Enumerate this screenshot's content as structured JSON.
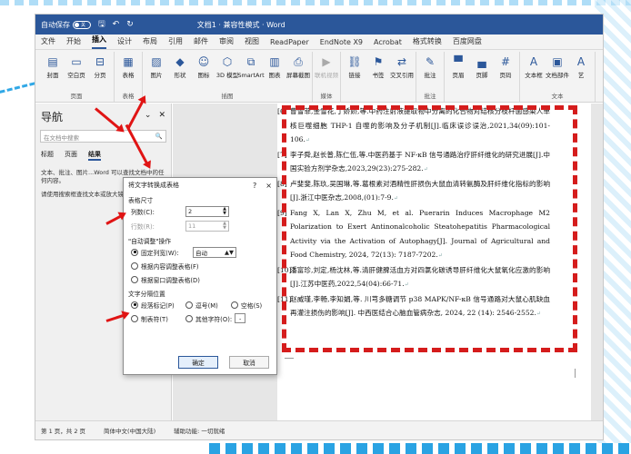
{
  "window": {
    "autosave_label": "自动保存",
    "autosave_state": "关",
    "title": "文档1 · 兼容性模式 · Word"
  },
  "tabs": [
    "文件",
    "开始",
    "插入",
    "设计",
    "布局",
    "引用",
    "邮件",
    "审阅",
    "视图",
    "ReadPaper",
    "EndNote X9",
    "Acrobat",
    "格式转换",
    "百度网盘"
  ],
  "ribbon": {
    "groups": [
      {
        "label": "页面",
        "buttons": [
          {
            "label": "封面",
            "icon": "cover-page-icon"
          },
          {
            "label": "空白页",
            "icon": "blank-page-icon"
          },
          {
            "label": "分页",
            "icon": "page-break-icon"
          }
        ]
      },
      {
        "label": "表格",
        "buttons": [
          {
            "label": "表格",
            "icon": "table-icon"
          }
        ]
      },
      {
        "label": "插图",
        "buttons": [
          {
            "label": "图片",
            "icon": "picture-icon"
          },
          {
            "label": "形状",
            "icon": "shapes-icon"
          },
          {
            "label": "图标",
            "icon": "icons-icon"
          },
          {
            "label": "3D 模型",
            "icon": "3d-model-icon"
          },
          {
            "label": "SmartArt",
            "icon": "smartart-icon"
          },
          {
            "label": "图表",
            "icon": "chart-icon"
          },
          {
            "label": "屏幕截图",
            "icon": "screenshot-icon"
          }
        ]
      },
      {
        "label": "媒体",
        "buttons": [
          {
            "label": "联机视频",
            "icon": "online-video-icon",
            "disabled": true
          }
        ]
      },
      {
        "label": "",
        "buttons": [
          {
            "label": "链接",
            "icon": "link-icon"
          },
          {
            "label": "书签",
            "icon": "bookmark-icon"
          },
          {
            "label": "交叉引用",
            "icon": "cross-reference-icon"
          }
        ]
      },
      {
        "label": "批注",
        "buttons": [
          {
            "label": "批注",
            "icon": "comment-icon"
          }
        ]
      },
      {
        "label": "",
        "buttons": [
          {
            "label": "页眉",
            "icon": "header-icon"
          },
          {
            "label": "页脚",
            "icon": "footer-icon"
          },
          {
            "label": "页码",
            "icon": "page-number-icon"
          }
        ]
      },
      {
        "label": "文本",
        "buttons": [
          {
            "label": "文本框",
            "icon": "text-box-icon"
          },
          {
            "label": "文档部件",
            "icon": "quick-parts-icon"
          },
          {
            "label": "艺",
            "icon": "wordart-icon"
          }
        ]
      }
    ]
  },
  "nav": {
    "title": "导航",
    "search_placeholder": "在文档中搜索",
    "tabs": [
      "标题",
      "页面",
      "结果"
    ],
    "msg1": "文本、批注、图片...Word 可以查找文档中的任何内容。",
    "msg2": "请使用搜索框查找文本或放大镜查找其他内容。"
  },
  "dialog": {
    "title": "将文字转换成表格",
    "help": "?",
    "close": "×",
    "size_section": "表格尺寸",
    "cols_label": "列数(C):",
    "cols_value": "2",
    "rows_label": "行数(R):",
    "rows_value": "11",
    "autofit_section": "\"自动调整\"操作",
    "fixed_label": "固定列宽(W):",
    "fixed_value": "自动",
    "content_label": "根据内容调整表格(F)",
    "window_label": "根据窗口调整表格(D)",
    "sep_section": "文字分隔位置",
    "sep_para": "段落标记(P)",
    "sep_comma": "逗号(M)",
    "sep_space": "空格(S)",
    "sep_tab": "制表符(T)",
    "sep_other": "其他字符(O):",
    "sep_other_value": "-",
    "ok": "确定",
    "cancel": "取消"
  },
  "references": [
    {
      "num": "[6]",
      "text": "曹雪菲,金雪花,丁娇娇,等.中药注射液提取物中分离的化合物对结核分枝杆菌感染人单核巨噬细胞 THP-1 自噬的影响及分子机制[J].临床误诊误治,2021,34(09):101-106."
    },
    {
      "num": "[7]",
      "text": "李子舜,赵长普,陈仁伍,等.中医药基于 NF-κB 信号通路治疗肝纤维化的研究进展[J].中国实验方剂学杂志,2023,29(23):275-282."
    },
    {
      "num": "[8]",
      "text": "卢斐斐,陈玖,吴国琳,等.葛根素对酒精性肝损伤大鼠血清转氨酶及肝纤维化指标的影响[J].浙江中医杂志,2008,(01):7-9."
    },
    {
      "num": "[9]",
      "text": "Fang X, Lan X, Zhu M, et al. Puerarin Induces Macrophage M2 Polarization to Exert Antinonalcoholic Steatohepatitis Pharmacological Activity via the Activation of Autophagy[J]. Journal of Agricultural and Food Chemistry, 2024, 72(13): 7187-7202."
    },
    {
      "num": "[10]",
      "text": "潘富珍,刘定,杨沈林,等.清肝健脾活血方对四氯化碳诱导肝纤维化大鼠氧化应激的影响[J].江苏中医药,2022,54(04):66-71."
    },
    {
      "num": "[11]",
      "text": "赵威瑾,李畅,李知娟,等. 川芎多糖调节 p38 MAPK/NF-κB 信号通路对大鼠心肌缺血再灌注损伤的影响[J]. 中西医结合心脑血管病杂志, 2024, 22 (14): 2546-2552."
    }
  ],
  "paragraph_mark": "↵",
  "status": {
    "page": "第 1 页，共 2 页",
    "lang": "简体中文(中国大陆)",
    "access": "辅助功能: 一切就绪"
  },
  "colors": {
    "accent": "#2b579a",
    "annotation": "#d51c1c"
  }
}
